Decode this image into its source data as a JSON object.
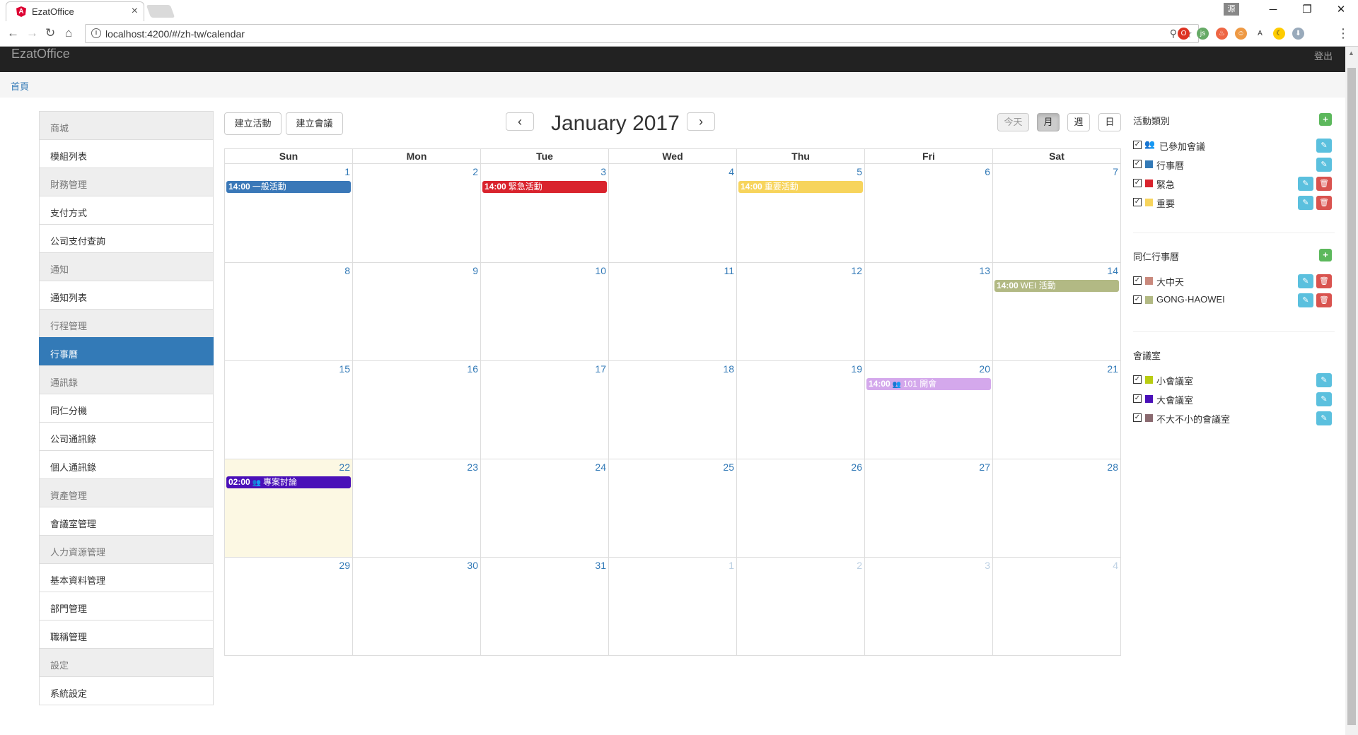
{
  "browser": {
    "tab_title": "EzatOffice",
    "url": "localhost:4200/#/zh-tw/calendar",
    "profile_label": "源"
  },
  "app": {
    "brand": "EzatOffice",
    "logout": "登出",
    "breadcrumb": "首頁"
  },
  "sidebar": {
    "items": [
      {
        "label": "商城",
        "type": "header"
      },
      {
        "label": "模組列表",
        "type": "item"
      },
      {
        "label": "財務管理",
        "type": "header"
      },
      {
        "label": "支付方式",
        "type": "item"
      },
      {
        "label": "公司支付查詢",
        "type": "item"
      },
      {
        "label": "通知",
        "type": "header"
      },
      {
        "label": "通知列表",
        "type": "item"
      },
      {
        "label": "行程管理",
        "type": "header"
      },
      {
        "label": "行事曆",
        "type": "active"
      },
      {
        "label": "通訊錄",
        "type": "header"
      },
      {
        "label": "同仁分機",
        "type": "item"
      },
      {
        "label": "公司通訊錄",
        "type": "item"
      },
      {
        "label": "個人通訊錄",
        "type": "item"
      },
      {
        "label": "資產管理",
        "type": "header"
      },
      {
        "label": "會議室管理",
        "type": "item"
      },
      {
        "label": "人力資源管理",
        "type": "header"
      },
      {
        "label": "基本資料管理",
        "type": "item"
      },
      {
        "label": "部門管理",
        "type": "item"
      },
      {
        "label": "職稱管理",
        "type": "item"
      },
      {
        "label": "設定",
        "type": "header"
      },
      {
        "label": "系統設定",
        "type": "item"
      }
    ]
  },
  "calendar": {
    "create_event": "建立活動",
    "create_meeting": "建立會議",
    "prev": "‹",
    "next": "›",
    "title": "January 2017",
    "today": "今天",
    "view_month": "月",
    "view_week": "週",
    "view_day": "日",
    "day_names": [
      "Sun",
      "Mon",
      "Tue",
      "Wed",
      "Thu",
      "Fri",
      "Sat"
    ],
    "weeks": [
      [
        {
          "n": "1"
        },
        {
          "n": "2"
        },
        {
          "n": "3"
        },
        {
          "n": "4"
        },
        {
          "n": "5"
        },
        {
          "n": "6"
        },
        {
          "n": "7"
        }
      ],
      [
        {
          "n": "8"
        },
        {
          "n": "9"
        },
        {
          "n": "10"
        },
        {
          "n": "11"
        },
        {
          "n": "12"
        },
        {
          "n": "13"
        },
        {
          "n": "14"
        }
      ],
      [
        {
          "n": "15"
        },
        {
          "n": "16"
        },
        {
          "n": "17"
        },
        {
          "n": "18"
        },
        {
          "n": "19"
        },
        {
          "n": "20"
        },
        {
          "n": "21"
        }
      ],
      [
        {
          "n": "22",
          "today": true
        },
        {
          "n": "23"
        },
        {
          "n": "24"
        },
        {
          "n": "25"
        },
        {
          "n": "26"
        },
        {
          "n": "27"
        },
        {
          "n": "28"
        }
      ],
      [
        {
          "n": "29"
        },
        {
          "n": "30"
        },
        {
          "n": "31"
        },
        {
          "n": "1",
          "other": true
        },
        {
          "n": "2",
          "other": true
        },
        {
          "n": "3",
          "other": true
        },
        {
          "n": "4",
          "other": true
        }
      ]
    ],
    "events": [
      {
        "week": 0,
        "day": 0,
        "time": "14:00",
        "title": "一般活動",
        "color": "#3a78b8",
        "icon": ""
      },
      {
        "week": 0,
        "day": 2,
        "time": "14:00",
        "title": "緊急活動",
        "color": "#d9232d",
        "icon": ""
      },
      {
        "week": 0,
        "day": 4,
        "time": "14:00",
        "title": "重要活動",
        "color": "#f7d45c",
        "icon": ""
      },
      {
        "week": 1,
        "day": 6,
        "time": "14:00",
        "title": "WEI 活動",
        "color": "#b2b984",
        "icon": ""
      },
      {
        "week": 2,
        "day": 5,
        "time": "14:00",
        "title": "101 開會",
        "color": "#d4a8ec",
        "icon": "people-icon"
      },
      {
        "week": 3,
        "day": 0,
        "time": "02:00",
        "title": "專案討論",
        "color": "#4a10b8",
        "icon": "people-icon"
      }
    ]
  },
  "right_panel": {
    "event_types_title": "活動類別",
    "event_types": [
      {
        "label": "已參加會議",
        "color": "",
        "icon": "people-icon",
        "deletable": false
      },
      {
        "label": "行事曆",
        "color": "#337ab7",
        "deletable": false
      },
      {
        "label": "緊急",
        "color": "#d9232d",
        "deletable": true
      },
      {
        "label": "重要",
        "color": "#f7d45c",
        "deletable": true
      }
    ],
    "colleague_title": "同仁行事曆",
    "colleagues": [
      {
        "label": "大中天",
        "color": "#c9897d",
        "deletable": true
      },
      {
        "label": "GONG-HAOWEI",
        "color": "#b2b984",
        "deletable": true
      }
    ],
    "rooms_title": "會議室",
    "rooms": [
      {
        "label": "小會議室",
        "color": "#b8cc12",
        "deletable": false
      },
      {
        "label": "大會議室",
        "color": "#4a10b8",
        "deletable": false
      },
      {
        "label": "不大不小的會議室",
        "color": "#8a6a70",
        "deletable": false
      }
    ]
  }
}
